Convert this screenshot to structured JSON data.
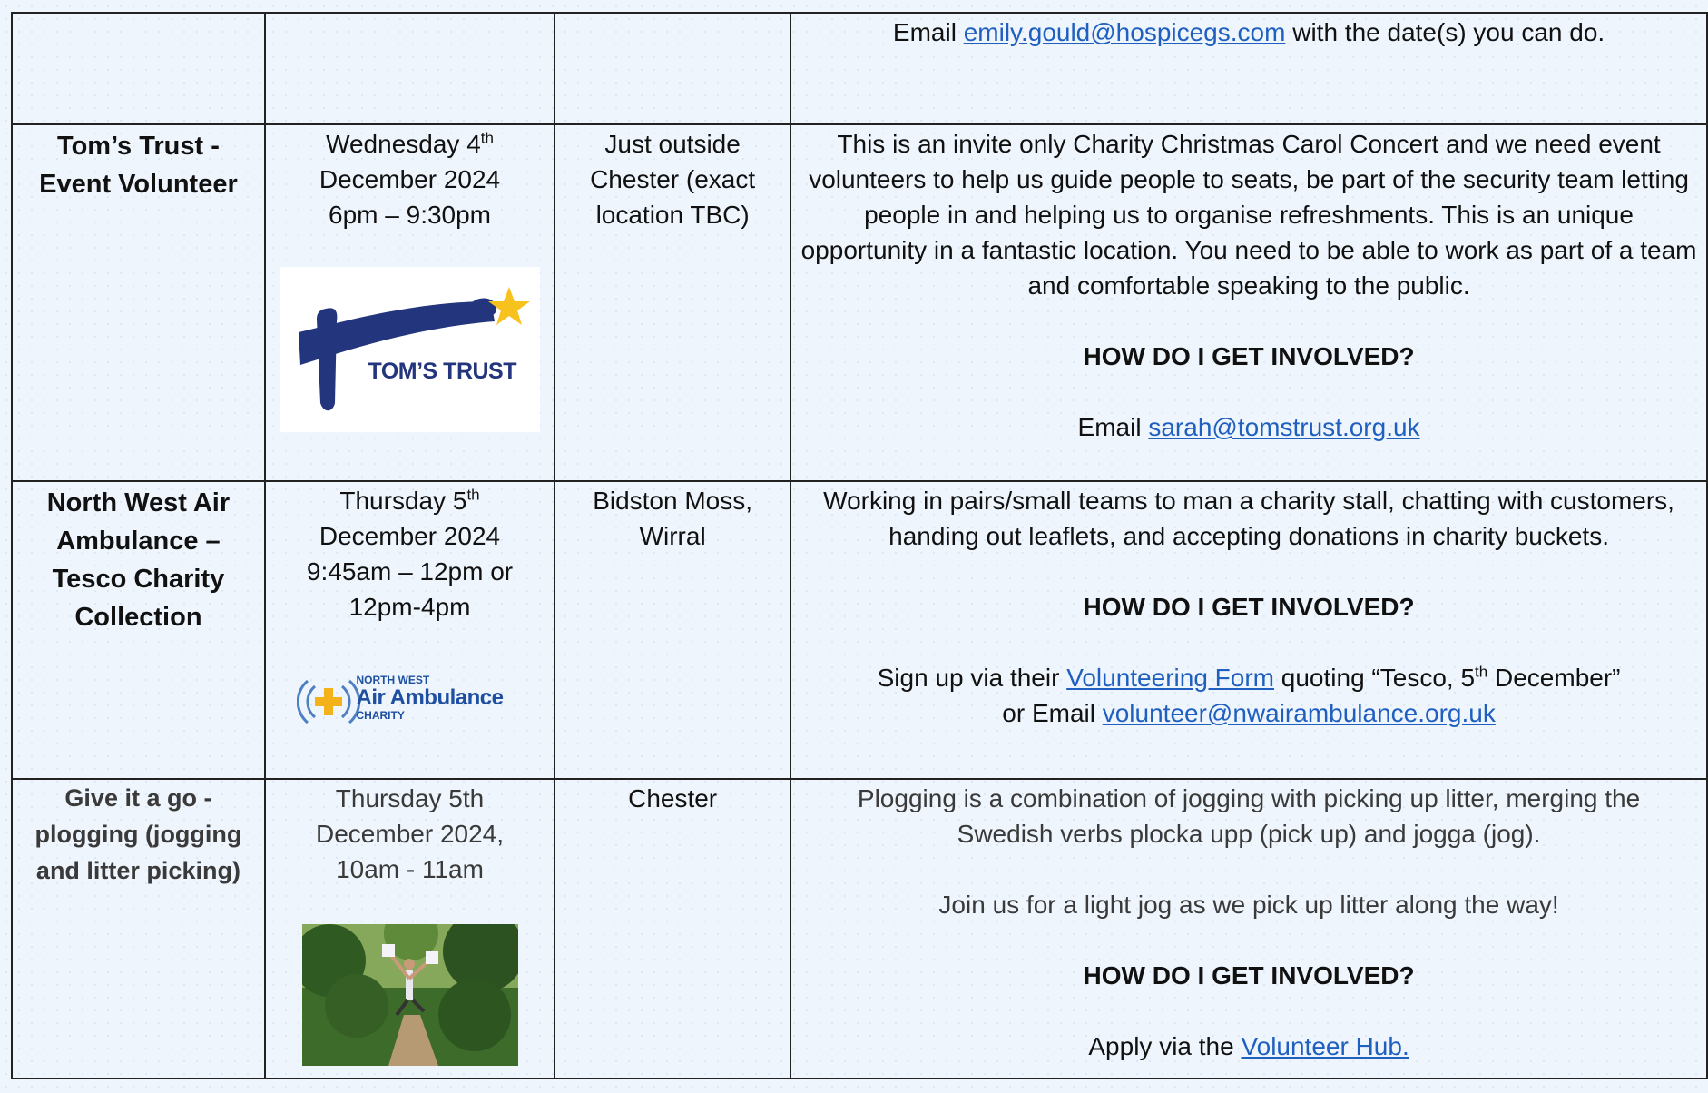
{
  "rows": [
    {
      "description": {
        "line_prefix": "Email ",
        "email": "emily.gould@hospicegs.com",
        "line_suffix": " with the date(s) you can do."
      }
    },
    {
      "title": "Tom’s Trust - Event Volunteer",
      "date": {
        "day": "Wednesday 4",
        "suffix": "th",
        "line2": "December 2024",
        "line3": "6pm – 9:30pm"
      },
      "location": "Just outside Chester (exact location TBC)",
      "description": {
        "paragraph": "This is an invite only Charity Christmas Carol Concert and we need event volunteers to help us guide people to seats, be part of the security team letting people in and helping us to organise refreshments.  This is an unique opportunity in a fantastic location.  You need to be able to work as part of a team and comfortable speaking to the public.",
        "heading": "HOW DO I GET INVOLVED?",
        "contact_prefix": "Email ",
        "email": "sarah@tomstrust.org.uk"
      },
      "logo_text": "TOM’S TRUST"
    },
    {
      "title": "North West Air Ambulance – Tesco Charity Collection",
      "date": {
        "day": "Thursday 5",
        "suffix": "th",
        "line2": "December 2024",
        "line3": "9:45am – 12pm or 12pm-4pm"
      },
      "location": "Bidston Moss, Wirral",
      "description": {
        "paragraph": "Working in pairs/small teams to man a charity stall, chatting with customers, handing out leaflets, and accepting donations in charity buckets.",
        "heading": "HOW DO I GET INVOLVED?",
        "signup_prefix": "Sign up via their ",
        "signup_link": "Volunteering Form",
        "signup_mid": " quoting “Tesco, 5",
        "signup_sup": "th",
        "signup_suffix": " December”",
        "contact_prefix": "or Email ",
        "email": "volunteer@nwairambulance.org.uk"
      },
      "logo_text": {
        "top": "NORTH WEST",
        "main": "Air Ambulance",
        "bottom": "CHARITY"
      }
    },
    {
      "title": "Give it a go - plogging (jogging and litter picking)",
      "date": {
        "text": "Thursday 5th December 2024, 10am - 11am"
      },
      "location": "Chester",
      "description": {
        "paragraph": "Plogging is a combination of jogging with picking up litter, merging the Swedish verbs plocka upp (pick up) and jogga (jog).",
        "paragraph2": "Join us for a light jog as we pick up litter along the way!",
        "heading": "HOW DO I GET INVOLVED?",
        "apply_prefix": "Apply via the ",
        "apply_link": "Volunteer Hub."
      }
    }
  ]
}
